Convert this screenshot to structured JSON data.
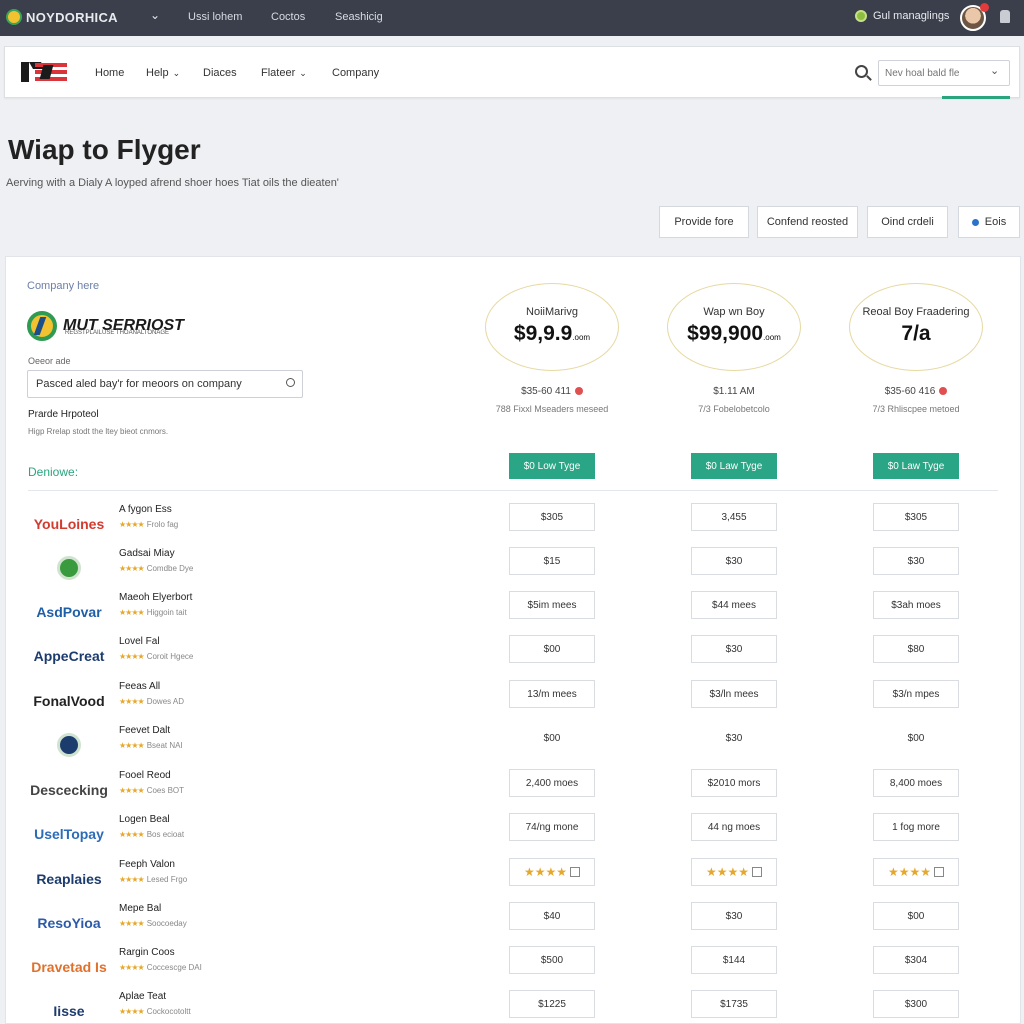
{
  "topbar": {
    "brand": "NOYDORHICA",
    "links": [
      "Ussi lohem",
      "Coctos",
      "Seashicig"
    ],
    "user_label": "Gul managlings"
  },
  "nav": {
    "items": [
      {
        "label": "Home",
        "dropdown": false
      },
      {
        "label": "Help",
        "dropdown": true
      },
      {
        "label": "Diaces",
        "dropdown": false
      },
      {
        "label": "Flateer",
        "dropdown": true
      },
      {
        "label": "Company",
        "dropdown": false
      }
    ],
    "search_placeholder": "Nev hoal bald fle"
  },
  "header": {
    "title": "Wiap to Flyger",
    "subtitle": "Aerving with a Dialy A loyped afrend shoer hoes Tiat oils the dieaten'"
  },
  "actions": [
    "Provide fore",
    "Confend reosted",
    "Oind crdeli",
    "Eois"
  ],
  "company": {
    "label": "Company here",
    "logo_name": "MUT SERRIOST",
    "logo_tagline": "REGSTPLAILUSE THOANALTONAGE",
    "field_label": "Oeeor ade",
    "input_value": "Pasced aled bay'r for meoors on company",
    "provide_heading": "Prarde Hrpoteol",
    "provide_sub": "Higp Rrelap stodt the ltey bieot cnmors.",
    "section_label": "Deniowe:"
  },
  "plans": [
    {
      "name": "NoiiMarivg",
      "price": "$9,9.9",
      "price_suffix": ".oom",
      "meta": "$35-60 411",
      "has_red_dot": true,
      "note": "788 Fixxl Mseaders meseed",
      "button": "$0 Low Tyge"
    },
    {
      "name": "Wap wn Boy",
      "price": "$99,900",
      "price_suffix": ".oom",
      "meta": "$1.11 AM",
      "has_red_dot": false,
      "note": "7/3 Fobelobetcolo",
      "button": "$0 Law Tyge"
    },
    {
      "name": "Reoal Boy Fraadering",
      "price": "7/a",
      "price_suffix": "",
      "meta": "$35-60 416",
      "has_red_dot": true,
      "note": "7/3 Rhliscpee metoed",
      "button": "$0 Law Tyge"
    }
  ],
  "rows": [
    {
      "logo": "YouLoines",
      "logo_color": "#d23b2e",
      "title": "A fygon Ess",
      "sub": "Frolo fag",
      "cells": [
        "$305",
        "3,455",
        "$305"
      ],
      "plain": false
    },
    {
      "logo": "",
      "logo_color": "#3a9a3e",
      "title": "Gadsai Miay",
      "sub": "Comdbe Dye",
      "cells": [
        "$15",
        "$30",
        "$30"
      ],
      "plain": false
    },
    {
      "logo": "AsdPovar",
      "logo_color": "#1f5fa8",
      "title": "Maeoh Elyerbort",
      "sub": "Higgoin tait",
      "cells": [
        "$5im mees",
        "$44 mees",
        "$3ah moes"
      ],
      "plain": false
    },
    {
      "logo": "AppeCreat",
      "logo_color": "#1d3c6e",
      "title": "Lovel Fal",
      "sub": "Coroit Hgece",
      "cells": [
        "$00",
        "$30",
        "$80"
      ],
      "plain": false
    },
    {
      "logo": "FonalVood",
      "logo_color": "#222222",
      "title": "Feeas All",
      "sub": "Dowes AD",
      "cells": [
        "13/m mees",
        "$3/ln mees",
        "$3/n mpes"
      ],
      "plain": false
    },
    {
      "logo": "",
      "logo_color": "#1d3c6e",
      "title": "Feevet Dalt",
      "sub": "Bseat NAI",
      "cells": [
        "$00",
        "$30",
        "$00"
      ],
      "plain": true
    },
    {
      "logo": "Descecking",
      "logo_color": "#444444",
      "title": "Fooel Reod",
      "sub": "Coes BOT",
      "cells": [
        "2,400 moes",
        "$2010 mors",
        "8,400 moes"
      ],
      "plain": false
    },
    {
      "logo": "UselTopay",
      "logo_color": "#2b6cb8",
      "title": "Logen Beal",
      "sub": "Bos ecioat",
      "cells": [
        "74/ng mone",
        "44 ng moes",
        "1 fog more"
      ],
      "plain": false
    },
    {
      "logo": "Reaplaies",
      "logo_color": "#1d3c6e",
      "title": "Feeph Valon",
      "sub": "Lesed Frgo",
      "cells": [
        "★★★★",
        "★★★★",
        "★★★★"
      ],
      "plain": false,
      "star_cells": true
    },
    {
      "logo": "ResoYioa",
      "logo_color": "#2b5aa8",
      "title": "Mepe Bal",
      "sub": "Soocoeday",
      "cells": [
        "$40",
        "$30",
        "$00"
      ],
      "plain": false
    },
    {
      "logo": "Dravetad Is",
      "logo_color": "#e1702a",
      "title": "Rargin Coos",
      "sub": "Coccescge DAI",
      "cells": [
        "$500",
        "$144",
        "$304"
      ],
      "plain": false
    },
    {
      "logo": "Iisse",
      "logo_color": "#1d3c6e",
      "title": "Aplae Teat",
      "sub": "Cockocotoltt",
      "cells": [
        "$1225",
        "$1735",
        "$300"
      ],
      "plain": false
    }
  ]
}
